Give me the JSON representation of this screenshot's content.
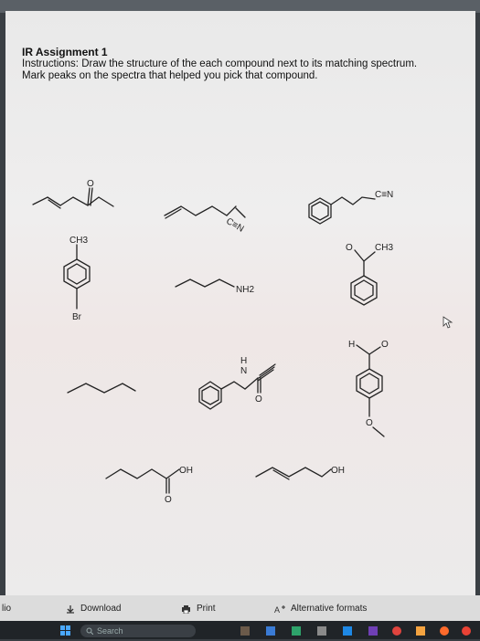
{
  "document": {
    "title": "IR Assignment 1",
    "instructions_1": "Instructions: Draw the structure of the each compound next to its matching spectrum.",
    "instructions_2": "Mark peaks on the spectra that helped you pick that compound."
  },
  "molecules": {
    "ketone_o": "O",
    "nitrile_propyl": "C≡N",
    "nitrile_benzyl": "C≡N",
    "toluene_ch3": "CH3",
    "toluene_br": "Br",
    "amine": "NH2",
    "acetophenone_o": "O",
    "acetophenone_ch3": "CH3",
    "aldehyde_h": "H",
    "aldehyde_o": "O",
    "amide_h": "H",
    "amide_n": "N",
    "amide_o": "O",
    "methoxy_o": "O",
    "acid_oh": "OH",
    "acid_o": "O",
    "alcohol_oh": "OH"
  },
  "bottom_bar": {
    "left_cut": "lio",
    "download": "Download",
    "print": "Print",
    "alt": "Alternative formats"
  },
  "taskbar": {
    "search": "Search"
  }
}
